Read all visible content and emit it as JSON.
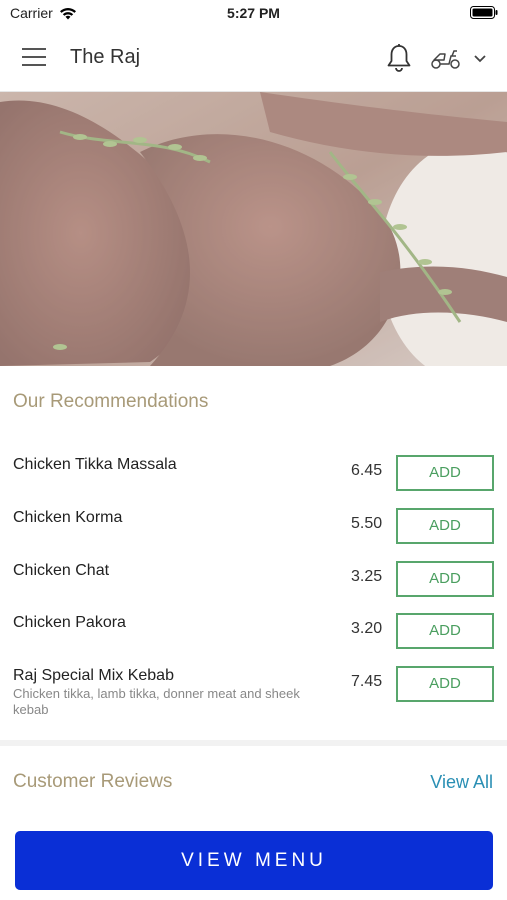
{
  "status": {
    "carrier": "Carrier",
    "time": "5:27 PM"
  },
  "header": {
    "title": "The Raj"
  },
  "recommendations": {
    "title": "Our Recommendations",
    "items": [
      {
        "name": "Chicken Tikka Massala",
        "description": "",
        "price": "6.45",
        "add_label": "ADD"
      },
      {
        "name": "Chicken Korma",
        "description": "",
        "price": "5.50",
        "add_label": "ADD"
      },
      {
        "name": "Chicken Chat",
        "description": "",
        "price": "3.25",
        "add_label": "ADD"
      },
      {
        "name": "Chicken Pakora",
        "description": "",
        "price": "3.20",
        "add_label": "ADD"
      },
      {
        "name": "Raj Special Mix Kebab",
        "description": "Chicken tikka, lamb tikka, donner meat and sheek kebab",
        "price": "7.45",
        "add_label": "ADD"
      }
    ]
  },
  "reviews": {
    "title": "Customer Reviews",
    "view_all": "View All"
  },
  "footer": {
    "view_menu": "VIEW MENU"
  },
  "colors": {
    "accent_gold": "#a89a78",
    "add_green": "#58a66c",
    "link_blue": "#2a8fb4",
    "primary_blue": "#0a2fd6"
  }
}
